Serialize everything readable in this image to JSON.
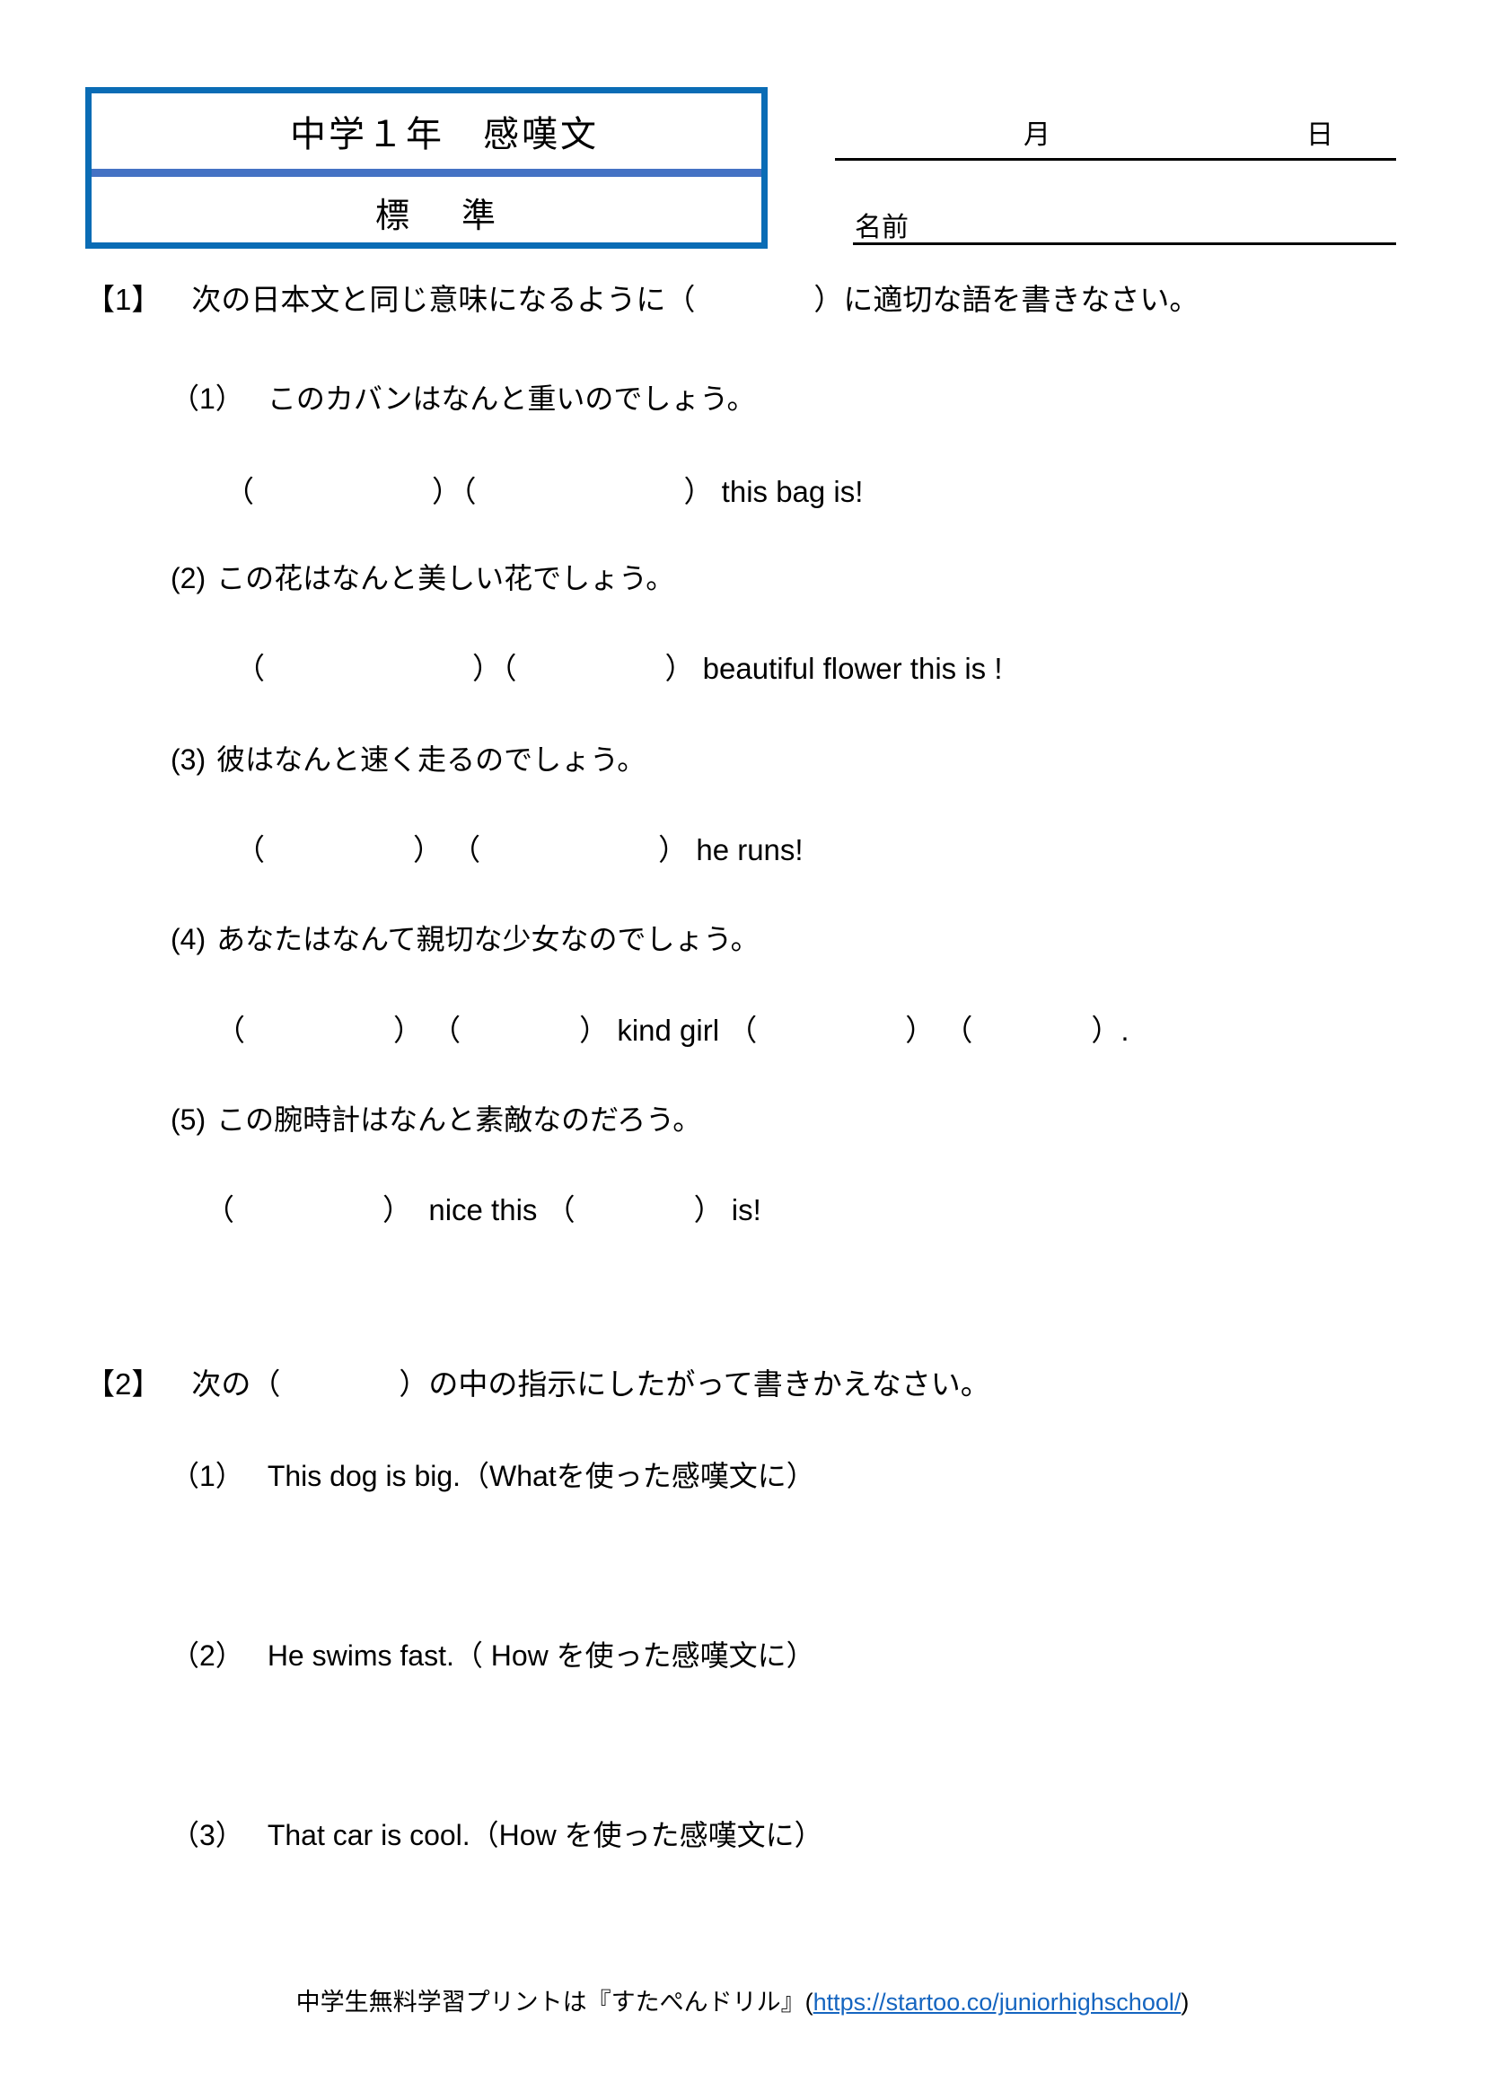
{
  "header": {
    "title": "中学１年　感嘆文",
    "level": "標　準",
    "date_month_label": "月",
    "date_day_label": "日",
    "name_label": "名前"
  },
  "sections": [
    {
      "number": "【1】",
      "instruction": "次の日本文と同じ意味になるように（　　　　）に適切な語を書きなさい。",
      "items": [
        {
          "number": "（1）",
          "jp": "このカバンはなんと重いのでしょう。",
          "answer": "（　　　　　　）（　　　　　　　） this bag is!"
        },
        {
          "number": "(2)",
          "jp": "この花はなんと美しい花でしょう。",
          "answer": "（　　　　　　　）（　　　　　） beautiful flower this is !"
        },
        {
          "number": "(3)",
          "jp": "彼はなんと速く走るのでしょう。",
          "answer": "（　　　　　） （　　　　　　） he runs!"
        },
        {
          "number": "(4)",
          "jp": "あなたはなんて親切な少女なのでしょう。",
          "answer": "（　　　　　） （　　　　） kind girl （　　　　　） （　　　　）."
        },
        {
          "number": "(5)",
          "jp": "この腕時計はなんと素敵なのだろう。",
          "answer": "（　　　　　）  nice this （　　　　） is!"
        }
      ]
    },
    {
      "number": "【2】",
      "instruction": "次の（　　　　）の中の指示にしたがって書きかえなさい。",
      "items": [
        {
          "number": "（1）",
          "jp": "This dog is big.（Whatを使った感嘆文に）",
          "answer": ""
        },
        {
          "number": "（2）",
          "jp": "He swims fast.（ How を使った感嘆文に）",
          "answer": ""
        },
        {
          "number": "（3）",
          "jp": "That car is cool.（How を使った感嘆文に）",
          "answer": ""
        }
      ]
    }
  ],
  "footer": {
    "prefix": "中学生無料学習プリントは『すたぺんドリル』(",
    "url": "https://startoo.co/juniorhighschool/",
    "suffix": ")"
  },
  "colors": {
    "box_border": "#0a6cb5",
    "box_divider": "#4472c4",
    "link": "#1565C0"
  }
}
